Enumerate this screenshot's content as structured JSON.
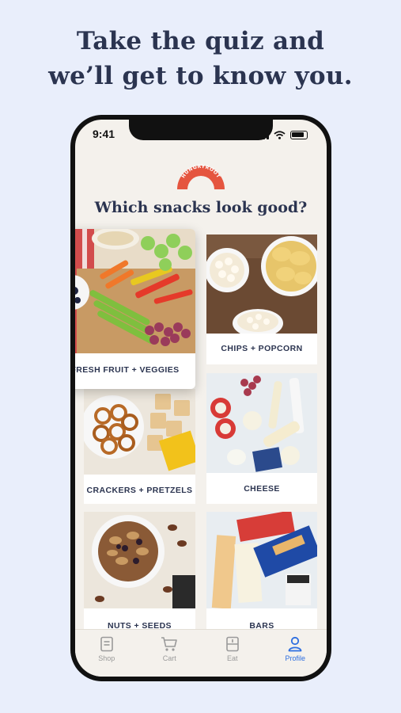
{
  "headline": {
    "line1": "Take the quiz and",
    "line2": "we’ll get to know you."
  },
  "status_bar": {
    "time": "9:41"
  },
  "brand": {
    "name": "HUNGRYROOT",
    "color": "#e5553f"
  },
  "quiz": {
    "question": "Which snacks look good?",
    "options": [
      {
        "label": "FRESH FRUIT + VEGGIES",
        "selected": true
      },
      {
        "label": "CHIPS + POPCORN",
        "selected": false
      },
      {
        "label": "CRACKERS + PRETZELS",
        "selected": false
      },
      {
        "label": "CHEESE",
        "selected": false
      },
      {
        "label": "NUTS + SEEDS",
        "selected": false
      },
      {
        "label": "BARS",
        "selected": false
      }
    ]
  },
  "tabbar": {
    "items": [
      {
        "label": "Shop",
        "icon": "shop-icon",
        "active": false
      },
      {
        "label": "Cart",
        "icon": "cart-icon",
        "active": false
      },
      {
        "label": "Eat",
        "icon": "eat-icon",
        "active": false
      },
      {
        "label": "Profile",
        "icon": "profile-icon",
        "active": true
      }
    ]
  },
  "colors": {
    "background": "#e9eefb",
    "text": "#2b3450",
    "accent": "#2d6ee0",
    "screen": "#f4f1ec"
  }
}
